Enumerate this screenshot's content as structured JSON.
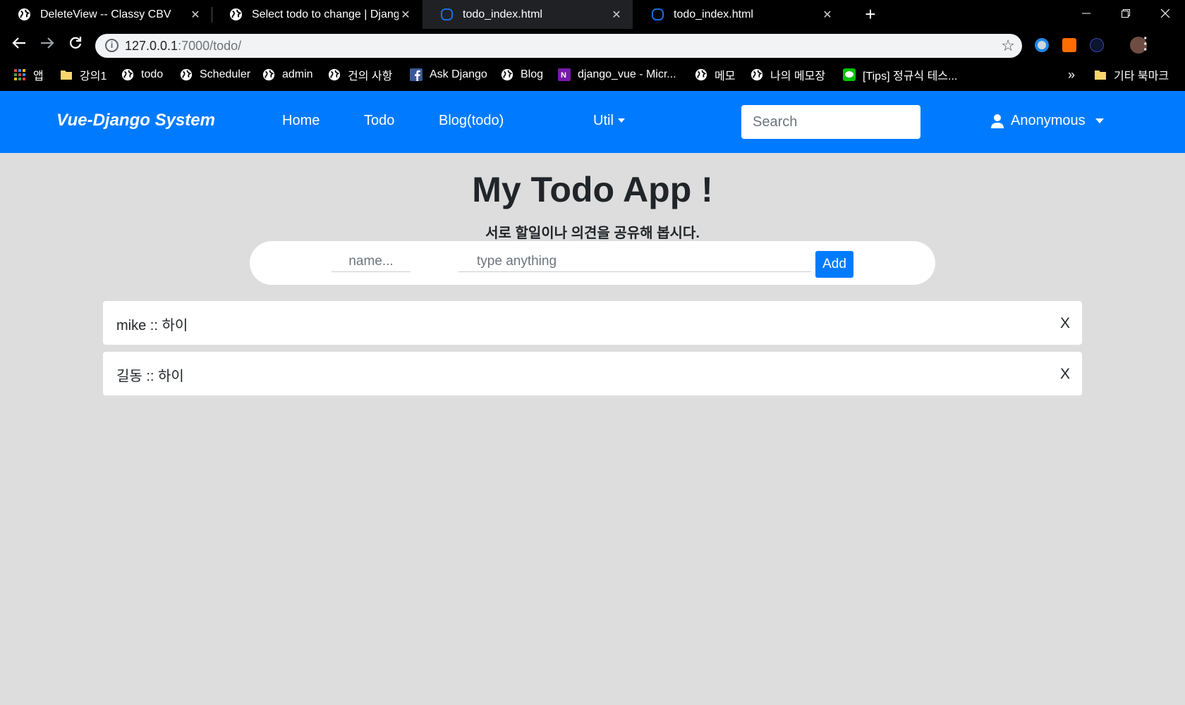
{
  "browser": {
    "tabs": [
      {
        "title": "DeleteView -- Classy CBV",
        "icon": "globe-icon",
        "active": false
      },
      {
        "title": "Select todo to change | Django",
        "icon": "globe-icon",
        "active": false
      },
      {
        "title": "todo_index.html",
        "icon": "page-icon",
        "active": true
      },
      {
        "title": "todo_index.html",
        "icon": "page-icon",
        "active": false
      }
    ],
    "tab_close": "✕",
    "new_tab": "+",
    "url_host": "127.0.0.1",
    "url_path": ":7000/todo/",
    "bookmarks": [
      {
        "label": "앱",
        "icon": "apps-grid-icon"
      },
      {
        "label": "강의1",
        "icon": "folder-icon"
      },
      {
        "label": "todo",
        "icon": "globe-icon"
      },
      {
        "label": "Scheduler",
        "icon": "globe-icon"
      },
      {
        "label": "admin",
        "icon": "globe-icon"
      },
      {
        "label": "건의 사항",
        "icon": "globe-icon"
      },
      {
        "label": "Ask Django",
        "icon": "facebook-icon"
      },
      {
        "label": "Blog",
        "icon": "globe-icon"
      },
      {
        "label": "django_vue - Micr...",
        "icon": "onenote-icon"
      },
      {
        "label": "메모",
        "icon": "globe-icon"
      },
      {
        "label": "나의 메모장",
        "icon": "globe-icon"
      },
      {
        "label": "[Tips] 정규식 테스...",
        "icon": "line-icon"
      }
    ],
    "bookmarks_overflow": "»",
    "other_bookmarks": "기타 북마크"
  },
  "navbar": {
    "brand": "Vue-Django System",
    "links": [
      "Home",
      "Todo",
      "Blog(todo)"
    ],
    "util": "Util",
    "search_placeholder": "Search",
    "user": "Anonymous"
  },
  "main": {
    "title": "My Todo App !",
    "subtitle": "서로 할일이나 의견을 공유해 봅시다.",
    "name_placeholder": "name...",
    "text_placeholder": "type anything",
    "add_label": "Add",
    "todos": [
      {
        "text": "mike :: 하이",
        "delete": "X"
      },
      {
        "text": "길동 :: 하이",
        "delete": "X"
      }
    ]
  },
  "colors": {
    "navbar": "#007bff",
    "page_background": "#dddddd",
    "chrome": "#000000"
  }
}
